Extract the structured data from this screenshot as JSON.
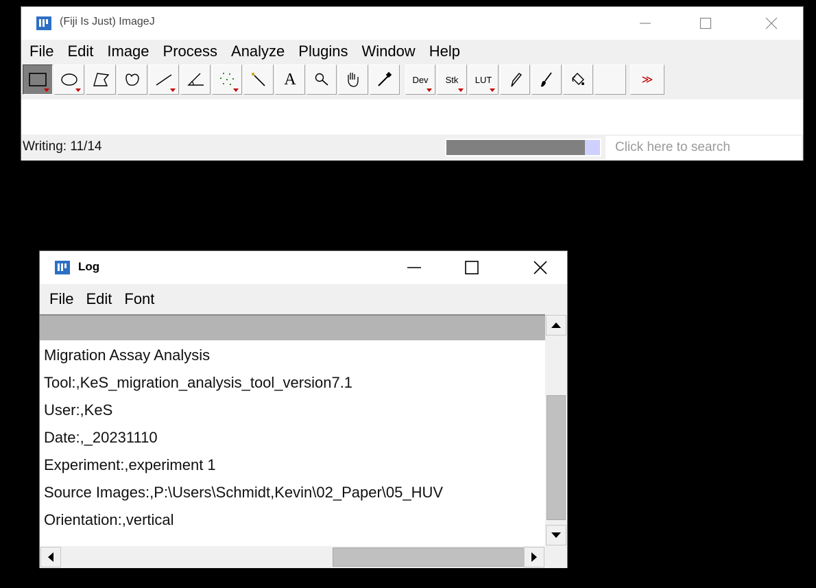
{
  "main_window": {
    "title": "(Fiji Is Just) ImageJ",
    "menu": [
      "File",
      "Edit",
      "Image",
      "Process",
      "Analyze",
      "Plugins",
      "Window",
      "Help"
    ],
    "tools": [
      {
        "name": "rectangle-tool",
        "icon": "rectangle-icon",
        "selected": true
      },
      {
        "name": "oval-tool",
        "icon": "oval-icon"
      },
      {
        "name": "polygon-tool",
        "icon": "polygon-icon"
      },
      {
        "name": "freehand-tool",
        "icon": "freehand-icon"
      },
      {
        "name": "line-tool",
        "icon": "line-icon"
      },
      {
        "name": "angle-tool",
        "icon": "angle-icon"
      },
      {
        "name": "point-tool",
        "icon": "multipoint-icon"
      },
      {
        "name": "wand-tool",
        "icon": "wand-icon"
      },
      {
        "name": "text-tool",
        "icon": "text-icon",
        "label": "A"
      },
      {
        "name": "magnifier-tool",
        "icon": "magnifier-icon"
      },
      {
        "name": "hand-tool",
        "icon": "hand-icon"
      },
      {
        "name": "dropper-tool",
        "icon": "dropper-icon"
      },
      {
        "name": "dev-menu",
        "label": "Dev"
      },
      {
        "name": "stk-menu",
        "label": "Stk"
      },
      {
        "name": "lut-menu",
        "label": "LUT"
      },
      {
        "name": "pencil-tool",
        "icon": "pencil-icon"
      },
      {
        "name": "brush-tool",
        "icon": "brush-icon"
      },
      {
        "name": "flood-fill-tool",
        "icon": "bucket-icon"
      },
      {
        "name": "empty-slot"
      },
      {
        "name": "more-tools",
        "label": "≫"
      }
    ],
    "status": "Writing: 11/14",
    "progress": {
      "fraction": 0.9
    },
    "search_placeholder": "Click here to search"
  },
  "log_window": {
    "title": "Log",
    "menu": [
      "File",
      "Edit",
      "Font"
    ],
    "lines": [
      "Migration Assay Analysis",
      "Tool:,KeS_migration_analysis_tool_version7.1",
      "User:,KeS",
      "Date:,_20231110",
      "Experiment:,experiment 1",
      "Source Images:,P:\\Users\\Schmidt,Kevin\\02_Paper\\05_HUV",
      "Orientation:,vertical"
    ]
  },
  "colors": {
    "selected_tool": "#7f7f7f",
    "menu_bg": "#f0f0f0",
    "progress_fill": "#808080",
    "progress_rest": "#cfd0ff",
    "dropdown_marker": "#c00000",
    "app_icon": "#2d6fc4"
  }
}
